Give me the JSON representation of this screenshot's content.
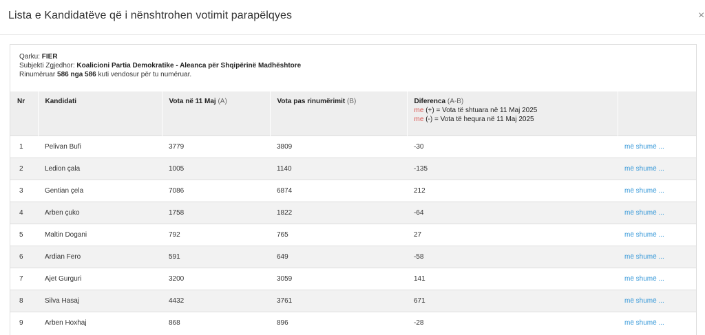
{
  "modal": {
    "title": "Lista e Kandidatëve që i nënshtrohen votimit parapëlqyes",
    "close_label": "×"
  },
  "info": {
    "qarku_label": "Qarku:",
    "qarku_value": "FIER",
    "subjekti_label": "Subjekti Zgjedhor:",
    "subjekti_value": "Koalicioni Partia Demokratike - Aleanca për Shqipërinë Madhështore",
    "rinumeruar_prefix": "Rinumëruar",
    "rinumeruar_value": "586 nga 586",
    "rinumeruar_suffix": "kuti vendosur për tu numëruar."
  },
  "table": {
    "headers": {
      "nr": "Nr",
      "kandidati": "Kandidati",
      "vota_a_label": "Vota në 11 Maj",
      "vota_a_sub": "(A)",
      "vota_b_label": "Vota pas rinumërimit",
      "vota_b_sub": "(B)",
      "diferenca_label": "Diferenca",
      "diferenca_sub": "(A-B)",
      "legend_plus_me": "me",
      "legend_plus_text": "(+) = Vota të shtuara në 11 Maj 2025",
      "legend_minus_me": "me",
      "legend_minus_text": "(-) = Vota të hequra në 11 Maj 2025"
    },
    "more_label": "më shumë ...",
    "rows": [
      {
        "nr": "1",
        "kandidati": "Pelivan Bufi",
        "vota_a": "3779",
        "vota_b": "3809",
        "diferenca": "-30"
      },
      {
        "nr": "2",
        "kandidati": "Ledion çala",
        "vota_a": "1005",
        "vota_b": "1140",
        "diferenca": "-135"
      },
      {
        "nr": "3",
        "kandidati": "Gentian çela",
        "vota_a": "7086",
        "vota_b": "6874",
        "diferenca": "212"
      },
      {
        "nr": "4",
        "kandidati": "Arben çuko",
        "vota_a": "1758",
        "vota_b": "1822",
        "diferenca": "-64"
      },
      {
        "nr": "5",
        "kandidati": "Maltin Dogani",
        "vota_a": "792",
        "vota_b": "765",
        "diferenca": "27"
      },
      {
        "nr": "6",
        "kandidati": "Ardian Fero",
        "vota_a": "591",
        "vota_b": "649",
        "diferenca": "-58"
      },
      {
        "nr": "7",
        "kandidati": "Ajet Gurguri",
        "vota_a": "3200",
        "vota_b": "3059",
        "diferenca": "141"
      },
      {
        "nr": "8",
        "kandidati": "Silva Hasaj",
        "vota_a": "4432",
        "vota_b": "3761",
        "diferenca": "671"
      },
      {
        "nr": "9",
        "kandidati": "Arben Hoxhaj",
        "vota_a": "868",
        "vota_b": "896",
        "diferenca": "-28"
      }
    ]
  },
  "colors": {
    "link": "#3a9ad9",
    "legend_red": "#d9534f",
    "header_bg": "#eeeeee",
    "stripe_bg": "#f2f2f2"
  }
}
